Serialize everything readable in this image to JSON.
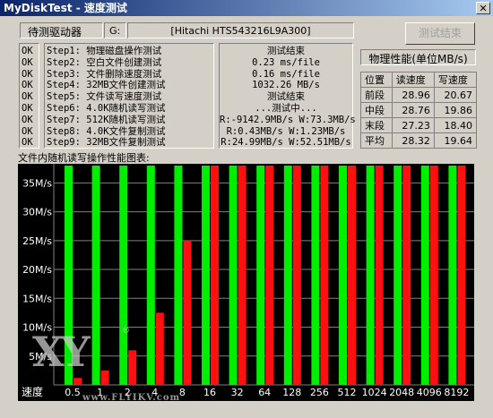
{
  "window": {
    "title": "MyDiskTest - 速度测试",
    "close_glyph": "✕"
  },
  "drive_bar": {
    "label": "待测驱动器",
    "drive": "G:",
    "model": "[Hitachi HTS543216L9A300]",
    "test_button": "测试结束"
  },
  "steps": {
    "status": [
      "OK",
      "OK",
      "OK",
      "OK",
      "OK",
      "OK",
      "OK",
      "OK",
      "OK"
    ],
    "names": [
      "Step1: 物理磁盘操作测试",
      "Step2: 空白文件创建测试",
      "Step3: 文件删除速度测试",
      "Step4: 32MB文件创建测试",
      "Step5: 文件读写速度测试",
      "Step6: 4.0K随机读写测试",
      "Step7: 512K随机读写测试",
      "Step8: 4.0K文件复制测试",
      "Step9: 32MB文件复制测试"
    ],
    "results": [
      "测试结束",
      "0.23 ms/file",
      "0.16 ms/file",
      "1032.26 MB/s",
      "测试结束",
      "...测试中...",
      "R:-9142.9MB/s W:73.3MB/s",
      "R:0.43MB/s W:1.23MB/s",
      "R:24.99MB/s W:52.51MB/s"
    ]
  },
  "performance": {
    "title": "物理性能(单位MB/s)",
    "headers": [
      "位置",
      "读速度",
      "写速度"
    ],
    "rows": [
      {
        "pos": "前段",
        "read": "28.96",
        "write": "20.67"
      },
      {
        "pos": "中段",
        "read": "28.76",
        "write": "19.86"
      },
      {
        "pos": "末段",
        "read": "27.23",
        "write": "18.40"
      },
      {
        "pos": "平均",
        "read": "28.32",
        "write": "19.64"
      }
    ]
  },
  "chart_label": "文件内随机读写操作性能图表:",
  "chart_data": {
    "type": "bar",
    "categories": [
      "0.5",
      "1",
      "2",
      "4",
      "8",
      "16",
      "32",
      "64",
      "128",
      "256",
      "512",
      "1024",
      "2048",
      "4096",
      "8192"
    ],
    "xlabel": "速度",
    "yticks": [
      "5M/s",
      "10M/s",
      "15M/s",
      "20M/s",
      "25M/s",
      "30M/s",
      "35M/s"
    ],
    "ylim": [
      0,
      38
    ],
    "series": [
      {
        "color": "#00ee00",
        "values": [
          38,
          38,
          38,
          38,
          38,
          38,
          38,
          38,
          38,
          38,
          38,
          38,
          38,
          38,
          38
        ]
      },
      {
        "color": "#ff1010",
        "values": [
          1.2,
          2.5,
          6.0,
          12.5,
          25.0,
          38,
          38,
          38,
          38,
          38,
          38,
          38,
          38,
          38,
          38
        ]
      }
    ],
    "colors": {
      "background": "#000000",
      "grid": "#808080",
      "text": "#ffffff"
    }
  },
  "watermark": {
    "logo": "XY",
    "registered": "®",
    "url": "www.FLYIKV.com"
  }
}
